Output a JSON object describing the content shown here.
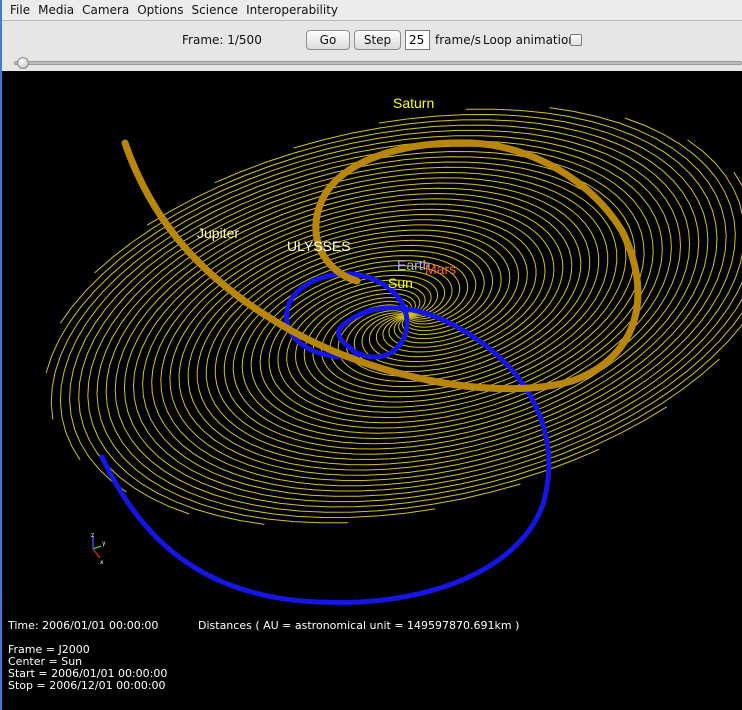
{
  "menu": [
    "File",
    "Media",
    "Camera",
    "Options",
    "Science",
    "Interoperability"
  ],
  "toolbar": {
    "frame_label": "Frame: 1/500",
    "go_label": "Go",
    "step_label": "Step",
    "fps_value": "25",
    "fps_unit": "frame/s",
    "loop_label": "Loop animation",
    "loop_checked": false
  },
  "slider": {
    "position": 0.0
  },
  "colors": {
    "field_lines": "#d4c21a",
    "ulysses_orbit": "#b8860b",
    "earth_orbit": "#1515e6",
    "saturn_label": "#ffff00",
    "jupiter_label": "#ffffc8",
    "ulysses_label": "#ffffff",
    "earth_label": "#aaaaff",
    "mars_label": "#ff6633",
    "sun_label": "#ffff00"
  },
  "bodies": {
    "saturn": "Saturn",
    "jupiter": "Jupiter",
    "ulysses": "ULYSSES",
    "earth": "Earth",
    "mars": "Mars",
    "sun": "Sun"
  },
  "axes": {
    "z": "z",
    "y": "y",
    "x": "x"
  },
  "info": {
    "time": "Time: 2006/01/01 00:00:00",
    "distances": "Distances ( AU = astronomical unit = 149597870.691km )",
    "frame": "Frame = J2000",
    "center": "Center = Sun",
    "start": "Start = 2006/01/01 00:00:00",
    "stop": "Stop = 2006/12/01 00:00:00"
  }
}
